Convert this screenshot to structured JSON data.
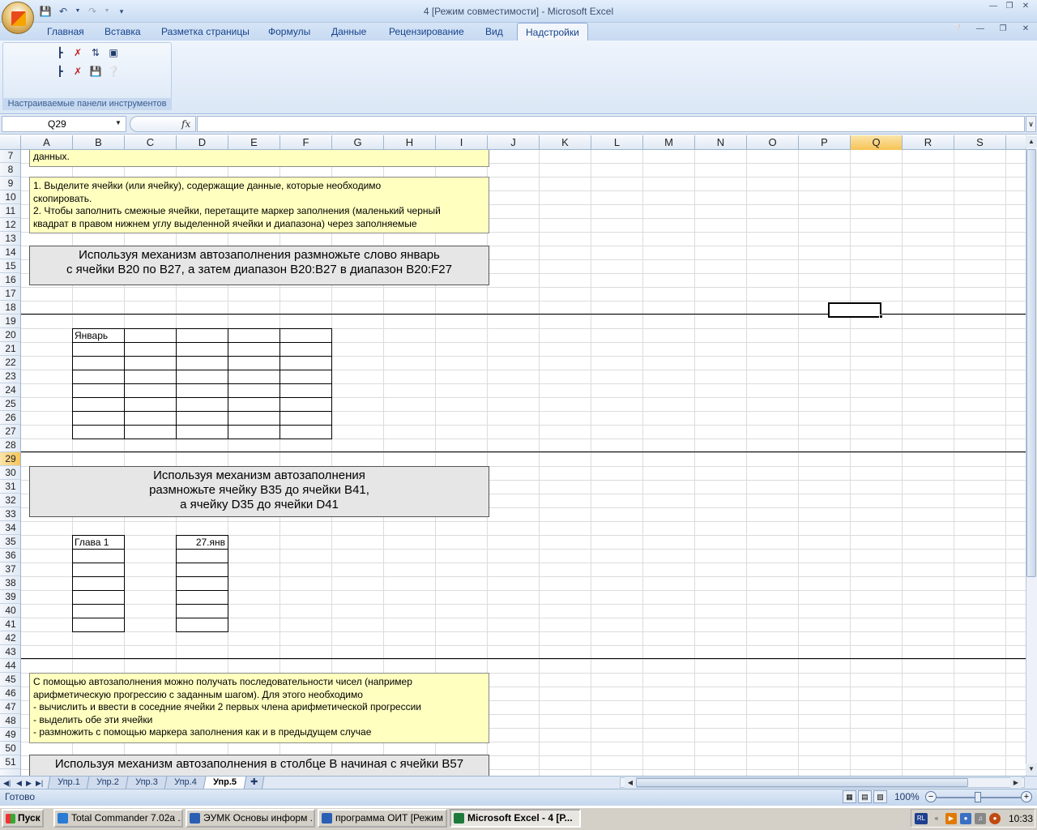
{
  "window": {
    "title": "4  [Режим совместимости] - Microsoft Excel"
  },
  "ribbon": {
    "tabs": [
      "Главная",
      "Вставка",
      "Разметка страницы",
      "Формулы",
      "Данные",
      "Рецензирование",
      "Вид",
      "Надстройки"
    ],
    "active_tab": "Надстройки",
    "group_label": "Настраиваемые панели инструментов"
  },
  "formula_bar": {
    "name_box": "Q29",
    "fx": "fx",
    "formula": ""
  },
  "columns": [
    "A",
    "B",
    "C",
    "D",
    "E",
    "F",
    "G",
    "H",
    "I",
    "J",
    "K",
    "L",
    "M",
    "N",
    "O",
    "P",
    "Q",
    "R",
    "S"
  ],
  "selected_column": "Q",
  "rows": [
    "7",
    "8",
    "9",
    "10",
    "11",
    "12",
    "13",
    "14",
    "15",
    "16",
    "17",
    "18",
    "19",
    "20",
    "21",
    "22",
    "23",
    "24",
    "25",
    "26",
    "27",
    "28",
    "29",
    "30",
    "31",
    "32",
    "33",
    "34",
    "35",
    "36",
    "37",
    "38",
    "39",
    "40",
    "41",
    "42",
    "43",
    "44",
    "45",
    "46",
    "47",
    "48",
    "49",
    "50",
    "51"
  ],
  "selected_row": "29",
  "content": {
    "note_top_tail": "данных.",
    "note1": [
      "1. Выделите ячейки (или ячейку), содержащие данные, которые необходимо",
      "скопировать.",
      "2. Чтобы заполнить смежные ячейки, перетащите маркер заполнения (маленький черный",
      "квадрат в правом нижнем углу выделенной ячейки и диапазона) через заполняемые"
    ],
    "task1": [
      "Используя механизм автозаполнения размножьте слово январь",
      "с ячейки B20 по B27, а затем диапазон B20:B27 в диапазон B20:F27"
    ],
    "cell_b20": "Январь",
    "task2": [
      "Используя механизм автозаполнения",
      "размножьте ячейку B35 до ячейки B41,",
      "а  ячейку D35 до ячейки D41"
    ],
    "cell_b35": "Глава 1",
    "cell_d35": "27.янв",
    "note2": [
      "С помощью автозаполнения  можно получать последовательности чисел (например",
      "арифметическую прогрессию с заданным шагом). Для этого необходимо",
      "- вычислить и ввести в соседние ячейки 2 первых члена арифметической прогрессии",
      "- выделить обе эти ячейки",
      "- размножить с помощью маркера заполнения  как и в предыдущем случае"
    ],
    "task3": "Используя механизм автозаполнения в столбце B начиная с ячейки B57"
  },
  "sheets": [
    "Упр.1",
    "Упр.2",
    "Упр.3",
    "Упр.4",
    "Упр.5"
  ],
  "active_sheet": "Упр.5",
  "status": {
    "text": "Готово",
    "zoom": "100%"
  },
  "taskbar": {
    "start": "Пуск",
    "items": [
      "Total Commander 7.02a ...",
      "ЭУМК Основы информ ...",
      "программа ОИТ [Режим ...",
      "Microsoft Excel - 4  [Р..."
    ],
    "active_item": 3,
    "lang": "RL",
    "clock": "10:33"
  }
}
